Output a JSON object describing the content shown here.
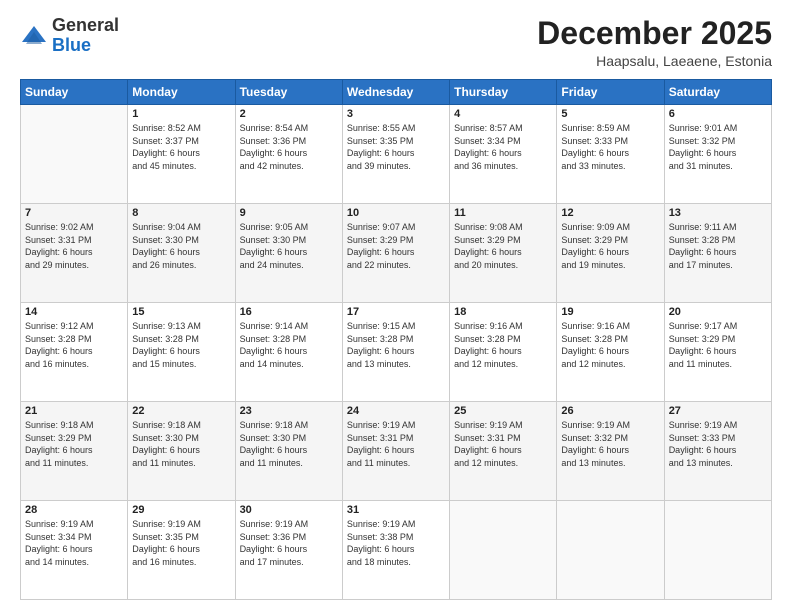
{
  "header": {
    "logo_general": "General",
    "logo_blue": "Blue",
    "month_title": "December 2025",
    "location": "Haapsalu, Laeaene, Estonia"
  },
  "weekdays": [
    "Sunday",
    "Monday",
    "Tuesday",
    "Wednesday",
    "Thursday",
    "Friday",
    "Saturday"
  ],
  "weeks": [
    [
      {
        "day": "",
        "info": ""
      },
      {
        "day": "1",
        "info": "Sunrise: 8:52 AM\nSunset: 3:37 PM\nDaylight: 6 hours\nand 45 minutes."
      },
      {
        "day": "2",
        "info": "Sunrise: 8:54 AM\nSunset: 3:36 PM\nDaylight: 6 hours\nand 42 minutes."
      },
      {
        "day": "3",
        "info": "Sunrise: 8:55 AM\nSunset: 3:35 PM\nDaylight: 6 hours\nand 39 minutes."
      },
      {
        "day": "4",
        "info": "Sunrise: 8:57 AM\nSunset: 3:34 PM\nDaylight: 6 hours\nand 36 minutes."
      },
      {
        "day": "5",
        "info": "Sunrise: 8:59 AM\nSunset: 3:33 PM\nDaylight: 6 hours\nand 33 minutes."
      },
      {
        "day": "6",
        "info": "Sunrise: 9:01 AM\nSunset: 3:32 PM\nDaylight: 6 hours\nand 31 minutes."
      }
    ],
    [
      {
        "day": "7",
        "info": "Sunrise: 9:02 AM\nSunset: 3:31 PM\nDaylight: 6 hours\nand 29 minutes."
      },
      {
        "day": "8",
        "info": "Sunrise: 9:04 AM\nSunset: 3:30 PM\nDaylight: 6 hours\nand 26 minutes."
      },
      {
        "day": "9",
        "info": "Sunrise: 9:05 AM\nSunset: 3:30 PM\nDaylight: 6 hours\nand 24 minutes."
      },
      {
        "day": "10",
        "info": "Sunrise: 9:07 AM\nSunset: 3:29 PM\nDaylight: 6 hours\nand 22 minutes."
      },
      {
        "day": "11",
        "info": "Sunrise: 9:08 AM\nSunset: 3:29 PM\nDaylight: 6 hours\nand 20 minutes."
      },
      {
        "day": "12",
        "info": "Sunrise: 9:09 AM\nSunset: 3:29 PM\nDaylight: 6 hours\nand 19 minutes."
      },
      {
        "day": "13",
        "info": "Sunrise: 9:11 AM\nSunset: 3:28 PM\nDaylight: 6 hours\nand 17 minutes."
      }
    ],
    [
      {
        "day": "14",
        "info": "Sunrise: 9:12 AM\nSunset: 3:28 PM\nDaylight: 6 hours\nand 16 minutes."
      },
      {
        "day": "15",
        "info": "Sunrise: 9:13 AM\nSunset: 3:28 PM\nDaylight: 6 hours\nand 15 minutes."
      },
      {
        "day": "16",
        "info": "Sunrise: 9:14 AM\nSunset: 3:28 PM\nDaylight: 6 hours\nand 14 minutes."
      },
      {
        "day": "17",
        "info": "Sunrise: 9:15 AM\nSunset: 3:28 PM\nDaylight: 6 hours\nand 13 minutes."
      },
      {
        "day": "18",
        "info": "Sunrise: 9:16 AM\nSunset: 3:28 PM\nDaylight: 6 hours\nand 12 minutes."
      },
      {
        "day": "19",
        "info": "Sunrise: 9:16 AM\nSunset: 3:28 PM\nDaylight: 6 hours\nand 12 minutes."
      },
      {
        "day": "20",
        "info": "Sunrise: 9:17 AM\nSunset: 3:29 PM\nDaylight: 6 hours\nand 11 minutes."
      }
    ],
    [
      {
        "day": "21",
        "info": "Sunrise: 9:18 AM\nSunset: 3:29 PM\nDaylight: 6 hours\nand 11 minutes."
      },
      {
        "day": "22",
        "info": "Sunrise: 9:18 AM\nSunset: 3:30 PM\nDaylight: 6 hours\nand 11 minutes."
      },
      {
        "day": "23",
        "info": "Sunrise: 9:18 AM\nSunset: 3:30 PM\nDaylight: 6 hours\nand 11 minutes."
      },
      {
        "day": "24",
        "info": "Sunrise: 9:19 AM\nSunset: 3:31 PM\nDaylight: 6 hours\nand 11 minutes."
      },
      {
        "day": "25",
        "info": "Sunrise: 9:19 AM\nSunset: 3:31 PM\nDaylight: 6 hours\nand 12 minutes."
      },
      {
        "day": "26",
        "info": "Sunrise: 9:19 AM\nSunset: 3:32 PM\nDaylight: 6 hours\nand 13 minutes."
      },
      {
        "day": "27",
        "info": "Sunrise: 9:19 AM\nSunset: 3:33 PM\nDaylight: 6 hours\nand 13 minutes."
      }
    ],
    [
      {
        "day": "28",
        "info": "Sunrise: 9:19 AM\nSunset: 3:34 PM\nDaylight: 6 hours\nand 14 minutes."
      },
      {
        "day": "29",
        "info": "Sunrise: 9:19 AM\nSunset: 3:35 PM\nDaylight: 6 hours\nand 16 minutes."
      },
      {
        "day": "30",
        "info": "Sunrise: 9:19 AM\nSunset: 3:36 PM\nDaylight: 6 hours\nand 17 minutes."
      },
      {
        "day": "31",
        "info": "Sunrise: 9:19 AM\nSunset: 3:38 PM\nDaylight: 6 hours\nand 18 minutes."
      },
      {
        "day": "",
        "info": ""
      },
      {
        "day": "",
        "info": ""
      },
      {
        "day": "",
        "info": ""
      }
    ]
  ]
}
